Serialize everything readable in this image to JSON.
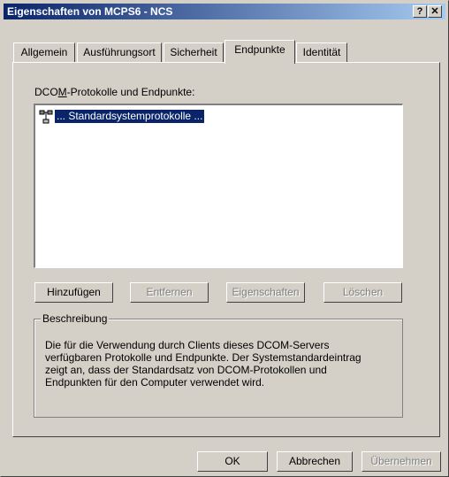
{
  "window": {
    "title": "Eigenschaften von MCPS6 - NCS",
    "help_label": "?",
    "close_label": "✕"
  },
  "tabs": [
    {
      "label": "Allgemein"
    },
    {
      "label": "Ausführungsort"
    },
    {
      "label": "Sicherheit"
    },
    {
      "label": "Endpunkte"
    },
    {
      "label": "Identität"
    }
  ],
  "active_tab": "Endpunkte",
  "endpoints": {
    "label_pre": "DCO",
    "label_accel": "M",
    "label_post": "-Protokolle und Endpunkte:",
    "items": [
      {
        "label": "... Standardsystemprotokolle ...",
        "icon": "connection-icon",
        "selected": true
      }
    ]
  },
  "buttons": {
    "add": "Hinzufügen",
    "remove": "Entfernen",
    "properties": "Eigenschaften",
    "delete": "Löschen"
  },
  "description": {
    "title": "Beschreibung",
    "lines": [
      "Die für die Verwendung durch Clients dieses DCOM-Servers",
      "verfügbaren Protokolle und Endpunkte. Der Systemstandardeintrag",
      "zeigt an, dass der Standardsatz von DCOM-Protokollen und",
      "Endpunkten für den Computer verwendet wird."
    ]
  },
  "footer": {
    "ok": "OK",
    "cancel": "Abbrechen",
    "apply": "Übernehmen"
  },
  "colors": {
    "titlebar_start": "#0a246a",
    "titlebar_end": "#a6caf0",
    "face": "#d4d0c8",
    "selection": "#0a246a"
  }
}
